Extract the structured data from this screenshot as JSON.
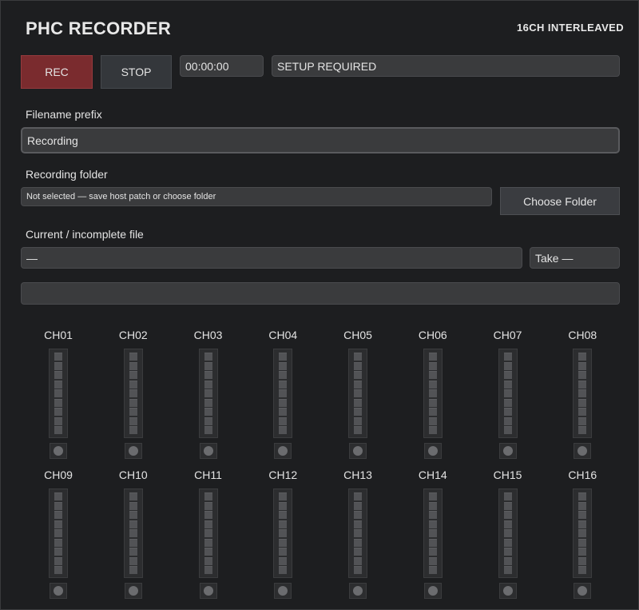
{
  "app": {
    "title": "PHC RECORDER",
    "mode": "16CH  INTERLEAVED"
  },
  "transport": {
    "rec_label": "REC",
    "stop_label": "STOP",
    "time": "00:00:00",
    "status": "SETUP REQUIRED"
  },
  "prefix": {
    "label": "Filename prefix",
    "value": "Recording"
  },
  "folder": {
    "label": "Recording folder",
    "value": "Not selected — save host patch or choose folder",
    "choose_label": "Choose Folder"
  },
  "current_file": {
    "label": "Current / incomplete file",
    "value": "—",
    "take": "Take —"
  },
  "progress": {
    "fraction": 0
  },
  "channels": [
    {
      "label": "CH01",
      "level": 0
    },
    {
      "label": "CH02",
      "level": 0
    },
    {
      "label": "CH03",
      "level": 0
    },
    {
      "label": "CH04",
      "level": 0
    },
    {
      "label": "CH05",
      "level": 0
    },
    {
      "label": "CH06",
      "level": 0
    },
    {
      "label": "CH07",
      "level": 0
    },
    {
      "label": "CH08",
      "level": 0
    },
    {
      "label": "CH09",
      "level": 0
    },
    {
      "label": "CH10",
      "level": 0
    },
    {
      "label": "CH11",
      "level": 0
    },
    {
      "label": "CH12",
      "level": 0
    },
    {
      "label": "CH13",
      "level": 0
    },
    {
      "label": "CH14",
      "level": 0
    },
    {
      "label": "CH15",
      "level": 0
    },
    {
      "label": "CH16",
      "level": 0
    }
  ],
  "colors": {
    "background": "#1d1e20",
    "rec": "#7a2b2e",
    "field": "#3a3b3d"
  }
}
